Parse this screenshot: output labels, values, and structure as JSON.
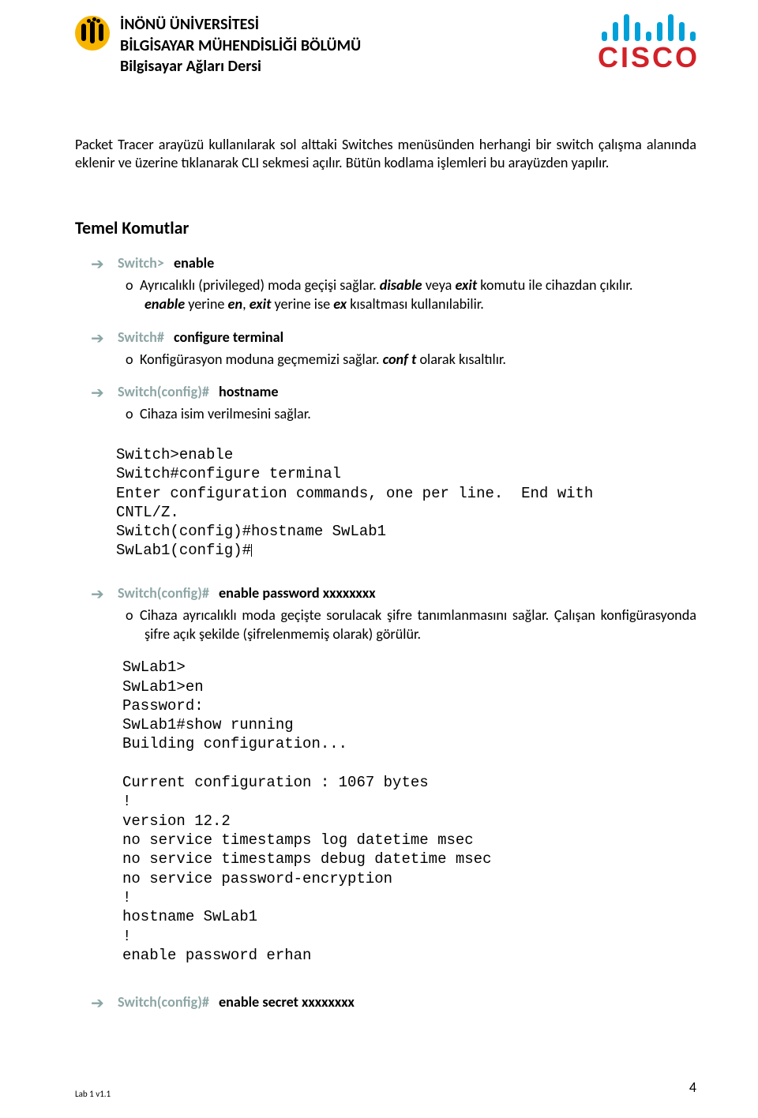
{
  "header": {
    "line1": "İNÖNÜ ÜNİVERSİTESİ",
    "line2": "BİLGİSAYAR MÜHENDİSLİĞİ BÖLÜMÜ",
    "line3": "Bilgisayar Ağları Dersi",
    "cisco": "CISCO"
  },
  "intro": "Packet Tracer arayüzü kullanılarak sol alttaki Switches menüsünden herhangi bir switch çalışma alanında eklenir ve üzerine tıklanarak CLI sekmesi açılır. Bütün kodlama işlemleri bu arayüzden yapılır.",
  "section": "Temel Komutlar",
  "cmd1": {
    "prompt": "Switch>",
    "cmd": "enable",
    "desc_pre": "Ayrıcalıklı (privileged) moda geçişi sağlar. ",
    "i1": "disable",
    "mid1": " veya ",
    "i2": "exit",
    "mid2": " komutu ile cihazdan çıkılır. ",
    "i3": "enable",
    "mid3": " yerine ",
    "i4": "en",
    "mid4": ", ",
    "i5": "exit",
    "mid5": " yerine ise ",
    "i6": "ex",
    "mid6": " kısaltması kullanılabilir."
  },
  "cmd2": {
    "prompt": "Switch#",
    "cmd": "configure terminal",
    "desc_pre": "Konfigürasyon moduna geçmemizi sağlar. ",
    "i1": "conf  t",
    "mid1": " olarak kısaltılır."
  },
  "cmd3": {
    "prompt": "Switch(config)#",
    "cmd": "hostname",
    "desc": "Cihaza isim verilmesini sağlar."
  },
  "term1": "Switch>enable\nSwitch#configure terminal\nEnter configuration commands, one per line.  End with\nCNTL/Z.\nSwitch(config)#hostname SwLab1\nSwLab1(config)#",
  "cmd4": {
    "prompt": "Switch(config)#",
    "cmd": "enable password  xxxxxxxx",
    "desc": "Cihaza ayrıcalıklı moda geçişte sorulacak şifre tanımlanmasını sağlar. Çalışan konfigürasyonda şifre açık şekilde (şifrelenmemiş olarak) görülür."
  },
  "term2": "SwLab1>\nSwLab1>en\nPassword:\nSwLab1#show running\nBuilding configuration...\n\nCurrent configuration : 1067 bytes\n!\nversion 12.2\nno service timestamps log datetime msec\nno service timestamps debug datetime msec\nno service password-encryption\n!\nhostname SwLab1\n!\nenable password erhan",
  "cmd5": {
    "prompt": "Switch(config)#",
    "cmd": "enable secret  xxxxxxxx"
  },
  "footer": {
    "left": "Lab 1  v1.1",
    "right": "4"
  }
}
